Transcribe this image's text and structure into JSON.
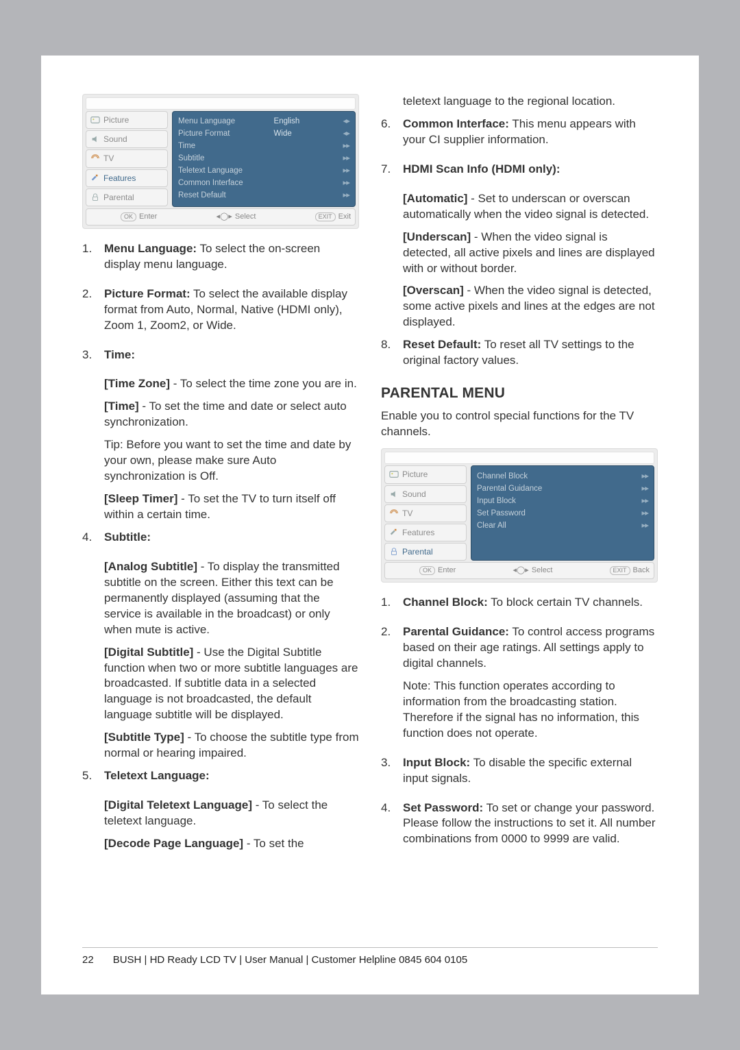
{
  "featuresMenu": {
    "sidebar": [
      {
        "label": "Picture",
        "icon": "picture"
      },
      {
        "label": "Sound",
        "icon": "sound"
      },
      {
        "label": "TV",
        "icon": "tv"
      },
      {
        "label": "Features",
        "icon": "features"
      },
      {
        "label": "Parental",
        "icon": "parental"
      }
    ],
    "selectedIndex": 3,
    "rows": [
      {
        "label": "Menu Language",
        "value": "English",
        "arrows": "◂▸"
      },
      {
        "label": "Picture Format",
        "value": "Wide",
        "arrows": "◂▸"
      },
      {
        "label": "Time",
        "value": "",
        "arrows": "▸▸"
      },
      {
        "label": "Subtitle",
        "value": "",
        "arrows": "▸▸"
      },
      {
        "label": "Teletext Language",
        "value": "",
        "arrows": "▸▸"
      },
      {
        "label": "Common Interface",
        "value": "",
        "arrows": "▸▸"
      },
      {
        "label": "Reset Default",
        "value": "",
        "arrows": "▸▸"
      }
    ],
    "footer": {
      "okKey": "OK",
      "okLabel": "Enter",
      "selectGlyph": "◂◯▸",
      "selectLabel": "Select",
      "exitKey": "EXIT",
      "exitLabel": "Exit"
    }
  },
  "parentalMenu": {
    "sidebar": [
      {
        "label": "Picture",
        "icon": "picture"
      },
      {
        "label": "Sound",
        "icon": "sound"
      },
      {
        "label": "TV",
        "icon": "tv"
      },
      {
        "label": "Features",
        "icon": "features"
      },
      {
        "label": "Parental",
        "icon": "parental"
      }
    ],
    "selectedIndex": 4,
    "rows": [
      {
        "label": "Channel Block",
        "value": "",
        "arrows": "▸▸"
      },
      {
        "label": "Parental Guidance",
        "value": "",
        "arrows": "▸▸"
      },
      {
        "label": "Input Block",
        "value": "",
        "arrows": "▸▸"
      },
      {
        "label": "Set Password",
        "value": "",
        "arrows": "▸▸"
      },
      {
        "label": "Clear All",
        "value": "",
        "arrows": "▸▸"
      }
    ],
    "footer": {
      "okKey": "OK",
      "okLabel": "Enter",
      "selectGlyph": "◂◯▸",
      "selectLabel": "Select",
      "exitKey": "EXIT",
      "exitLabel": "Back"
    }
  },
  "left": {
    "item1": {
      "num": "1.",
      "title": "Menu Language:",
      "rest": " To select the on-screen display menu language."
    },
    "item2": {
      "num": "2.",
      "title": "Picture Format:",
      "rest": " To select the available display format from Auto, Normal, Native (HDMI only), Zoom 1, Zoom2, or Wide."
    },
    "item3": {
      "num": "3.",
      "title": "Time:"
    },
    "time_zone": {
      "title": "[Time Zone]",
      "rest": " - To select the time zone you are in."
    },
    "time": {
      "title": "[Time]",
      "rest": " - To set the time and date or select auto synchronization."
    },
    "tip": "Tip: Before you want to set the time and date by your own, please make sure Auto synchronization is Off.",
    "sleep": {
      "title": "[Sleep Timer]",
      "rest": " - To set the TV to turn itself off within a certain time."
    },
    "item4": {
      "num": "4.",
      "title": "Subtitle:"
    },
    "analog": {
      "title": "[Analog Subtitle]",
      "rest": " - To display the transmitted subtitle on the screen. Either this text can be permanently displayed (assuming that the service is available in the broadcast) or only when mute is active."
    },
    "digital": {
      "title": "[Digital Subtitle]",
      "rest": " - Use the Digital Subtitle function when two or more subtitle languages are broadcasted. If subtitle data in a selected language is not broadcasted, the default language subtitle will be displayed."
    },
    "subtype": {
      "title": "[Subtitle Type]",
      "rest": " - To choose the subtitle type from normal or hearing impaired."
    },
    "item5": {
      "num": "5.",
      "title": "Teletext Language:"
    },
    "digttx": {
      "title": "[Digital Teletext Language]",
      "rest": " - To select the teletext language."
    },
    "decode": {
      "title": "[Decode Page Language]",
      "rest": " - To set the"
    }
  },
  "right": {
    "cont": "teletext language to the regional location.",
    "item6": {
      "num": "6.",
      "title": "Common Interface:",
      "rest": " This menu appears with your CI supplier information."
    },
    "item7": {
      "num": "7.",
      "title": "HDMI Scan Info (HDMI only):"
    },
    "auto": {
      "title": "[Automatic]",
      "rest": " - Set to underscan or overscan automatically when the video signal is detected."
    },
    "under": {
      "title": "[Underscan]",
      "rest": " - When the video signal is detected, all active pixels and lines are displayed with or without border."
    },
    "over": {
      "title": "[Overscan]",
      "rest": " - When the video signal is detected, some active pixels and lines at the edges are not displayed."
    },
    "item8": {
      "num": "8.",
      "title": "Reset Default:",
      "rest": " To reset all TV settings to the original factory values."
    },
    "heading": "PARENTAL MENU",
    "intro": "Enable you to control special functions for the TV channels.",
    "p1": {
      "num": "1.",
      "title": "Channel Block:",
      "rest": " To block certain TV channels."
    },
    "p2": {
      "num": "2.",
      "title": "Parental Guidance:",
      "rest": " To control access programs based on their age ratings. All settings apply to digital channels."
    },
    "p2note": "Note: This function operates according to information from the broadcasting station. Therefore if the signal has no information, this function does not operate.",
    "p3": {
      "num": "3.",
      "title": "Input Block:",
      "rest": " To disable the specific external input signals."
    },
    "p4": {
      "num": "4.",
      "title": "Set Password:",
      "rest": " To set or change your password. Please follow the instructions to set it. All number combinations from 0000 to 9999 are valid."
    }
  },
  "footer": {
    "pageNum": "22",
    "text": "BUSH | HD Ready LCD TV | User Manual | Customer Helpline 0845 604 0105"
  }
}
